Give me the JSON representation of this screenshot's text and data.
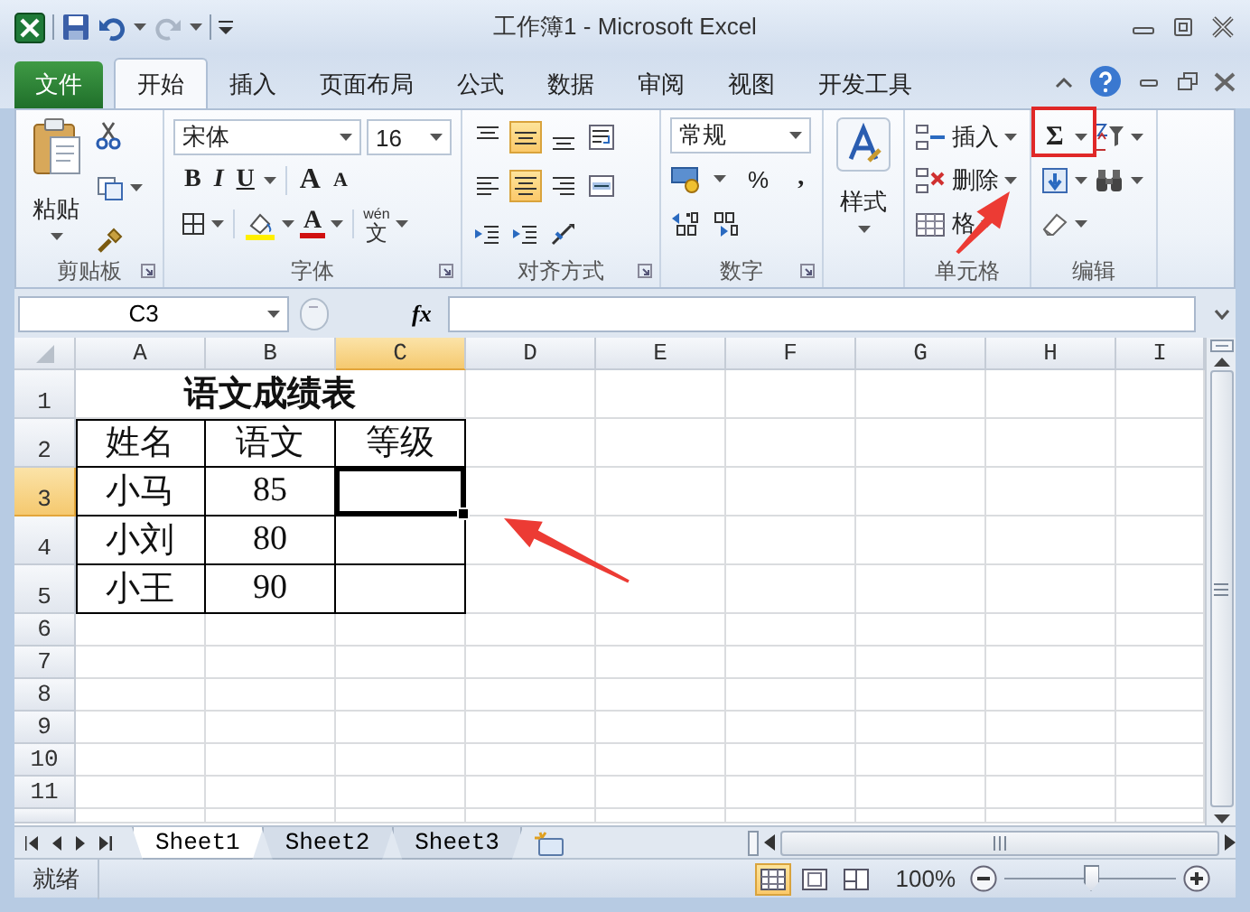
{
  "window": {
    "title": "工作簿1 - Microsoft Excel"
  },
  "ribbon_tabs": [
    {
      "label": "文件",
      "kind": "file",
      "selected": false
    },
    {
      "label": "开始",
      "kind": "tab",
      "selected": true
    },
    {
      "label": "插入",
      "kind": "tab",
      "selected": false
    },
    {
      "label": "页面布局",
      "kind": "tab",
      "selected": false
    },
    {
      "label": "公式",
      "kind": "tab",
      "selected": false
    },
    {
      "label": "数据",
      "kind": "tab",
      "selected": false
    },
    {
      "label": "审阅",
      "kind": "tab",
      "selected": false
    },
    {
      "label": "视图",
      "kind": "tab",
      "selected": false
    },
    {
      "label": "开发工具",
      "kind": "tab",
      "selected": false
    }
  ],
  "ribbon": {
    "clipboard": {
      "label": "剪贴板",
      "paste": "粘贴"
    },
    "font": {
      "label": "字体",
      "font_name": "宋体",
      "font_size": "16",
      "bold": "B",
      "italic": "I",
      "underline": "U",
      "grow": "A",
      "shrink": "A",
      "font_color": "A",
      "phonetic_top": "wén",
      "phonetic": "文"
    },
    "alignment": {
      "label": "对齐方式",
      "buttons": [
        {
          "kind": "top",
          "selected": false
        },
        {
          "kind": "middle",
          "selected": true
        },
        {
          "kind": "bottom",
          "selected": false
        },
        {
          "kind": "wrap",
          "selected": false
        },
        {
          "kind": "left",
          "selected": false
        },
        {
          "kind": "center",
          "selected": true
        },
        {
          "kind": "right",
          "selected": false
        },
        {
          "kind": "merge",
          "selected": false
        },
        {
          "kind": "outdent",
          "selected": false
        },
        {
          "kind": "indent",
          "selected": false
        },
        {
          "kind": "orientation",
          "selected": false
        }
      ]
    },
    "number": {
      "label": "数字",
      "format": "常规",
      "percent": "%",
      "comma": ","
    },
    "styles": {
      "button": "样式"
    },
    "cells": {
      "label": "单元格",
      "insert": "插入",
      "delete": "删除",
      "format": "格"
    },
    "editing": {
      "label": "编辑",
      "autosum": "Σ"
    }
  },
  "formula_bar": {
    "name_box": "C3",
    "function_label": "fx"
  },
  "sheet": {
    "columns": [
      {
        "label": "A",
        "selected": false
      },
      {
        "label": "B",
        "selected": false
      },
      {
        "label": "C",
        "selected": true
      },
      {
        "label": "D",
        "selected": false
      },
      {
        "label": "E",
        "selected": false
      },
      {
        "label": "F",
        "selected": false
      },
      {
        "label": "G",
        "selected": false
      },
      {
        "label": "H",
        "selected": false
      },
      {
        "label": "I",
        "selected": false
      }
    ],
    "rows": [
      {
        "label": "1",
        "selected": false,
        "cells": [
          {
            "kind": "title",
            "text": "语文成绩表",
            "selected": false
          }
        ]
      },
      {
        "label": "2",
        "selected": false,
        "cells": [
          {
            "kind": "table",
            "text": "姓名",
            "selected": false
          },
          {
            "kind": "table",
            "text": "语文",
            "selected": false
          },
          {
            "kind": "table",
            "text": "等级",
            "selected": false
          }
        ]
      },
      {
        "label": "3",
        "selected": true,
        "cells": [
          {
            "kind": "table",
            "text": "小马",
            "selected": false
          },
          {
            "kind": "table",
            "text": "85",
            "selected": false
          },
          {
            "kind": "table",
            "selected": true
          }
        ]
      },
      {
        "label": "4",
        "selected": false,
        "cells": [
          {
            "kind": "table",
            "text": "小刘",
            "selected": false
          },
          {
            "kind": "table",
            "text": "80",
            "selected": false
          },
          {
            "kind": "table",
            "selected": false
          }
        ]
      },
      {
        "label": "5",
        "selected": false,
        "cells": [
          {
            "kind": "table",
            "text": "小王",
            "selected": false
          },
          {
            "kind": "table",
            "text": "90",
            "selected": false
          },
          {
            "kind": "table",
            "selected": false
          }
        ]
      },
      {
        "label": "6",
        "selected": false
      },
      {
        "label": "7",
        "selected": false
      },
      {
        "label": "8",
        "selected": false
      },
      {
        "label": "9",
        "selected": false
      },
      {
        "label": "10",
        "selected": false
      },
      {
        "label": "11",
        "selected": false
      }
    ]
  },
  "sheet_tabs": [
    {
      "label": "Sheet1",
      "selected": true
    },
    {
      "label": "Sheet2",
      "selected": false
    },
    {
      "label": "Sheet3",
      "selected": false
    }
  ],
  "status_bar": {
    "status": "就绪",
    "views": [
      {
        "kind": "normal",
        "selected": true
      },
      {
        "kind": "page_layout",
        "selected": false
      },
      {
        "kind": "page_break",
        "selected": false
      }
    ],
    "zoom": "100%",
    "zoom_slider": {
      "level": 0.5
    }
  }
}
